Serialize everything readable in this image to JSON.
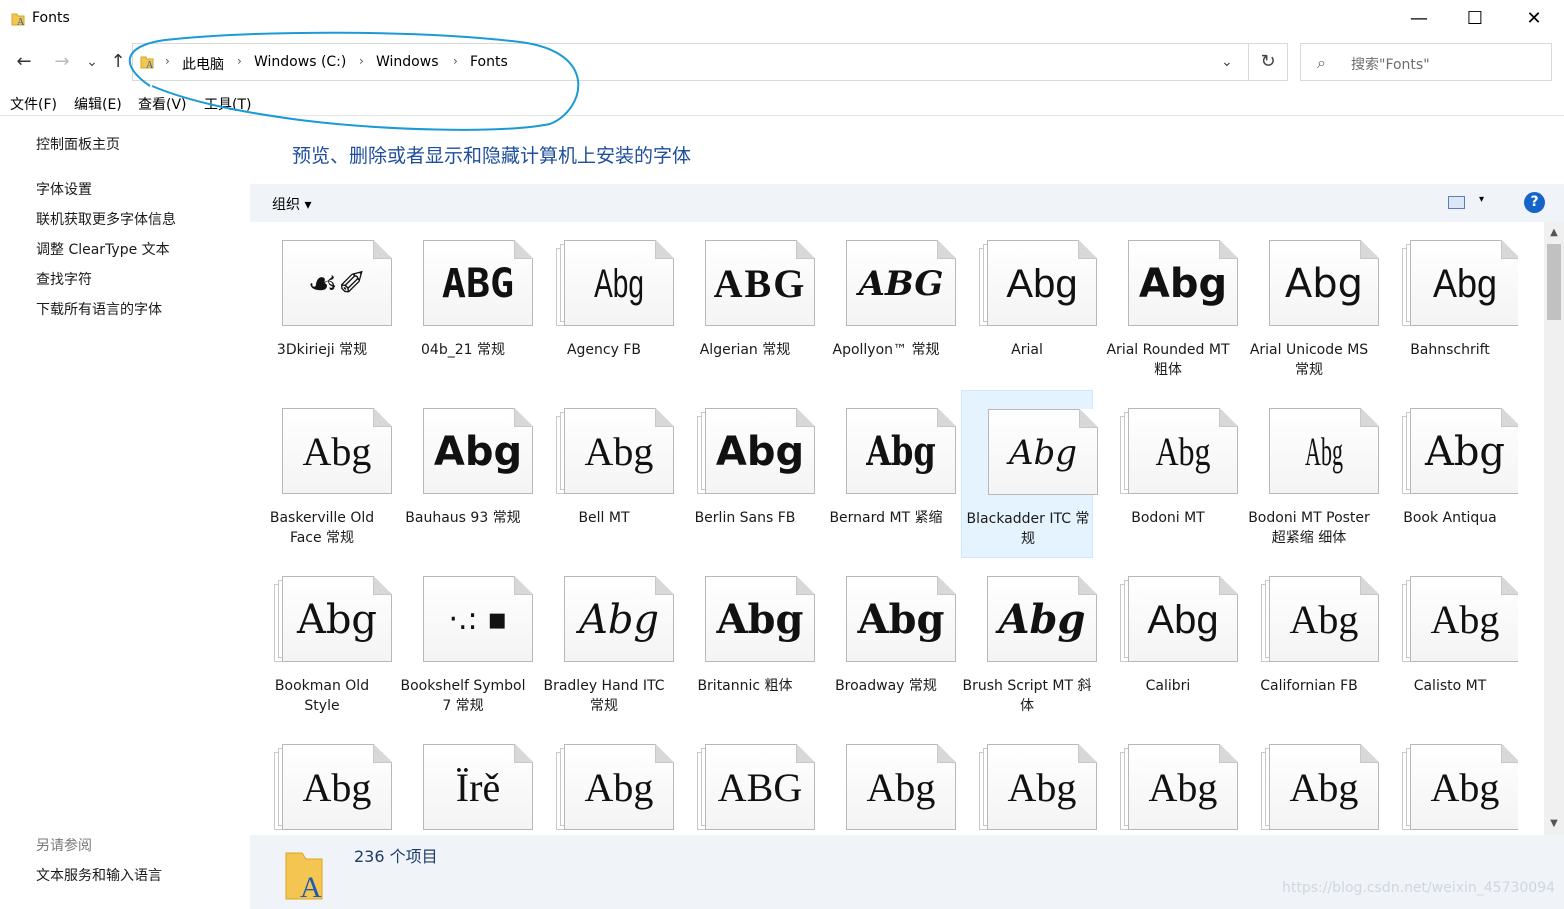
{
  "window": {
    "title": "Fonts",
    "minimize": "—",
    "maximize": "☐",
    "close": "✕"
  },
  "nav": {
    "back": "←",
    "forward": "→",
    "recent": "⌄",
    "up": "↑"
  },
  "address": {
    "segments": [
      "此电脑",
      "Windows (C:)",
      "Windows",
      "Fonts"
    ],
    "chevron": "›",
    "dropdown": "⌄",
    "refresh": "↻"
  },
  "search": {
    "icon": "⌕",
    "placeholder": "搜索\"Fonts\""
  },
  "menu": [
    "文件(F)",
    "编辑(E)",
    "查看(V)",
    "工具(T)"
  ],
  "sidebar": {
    "home": "控制面板主页",
    "links": [
      "字体设置",
      "联机获取更多字体信息",
      "调整 ClearType 文本",
      "查找字符",
      "下载所有语言的字体"
    ],
    "see_also_title": "另请参阅",
    "see_also": [
      "文本服务和输入语言"
    ]
  },
  "heading": "预览、删除或者显示和隐藏计算机上安装的字体",
  "toolbar": {
    "organize": "组织 ▾",
    "view_dropdown": "▾",
    "help": "?"
  },
  "fonts": [
    {
      "name": "3Dkirieji 常规",
      "sample": "☙✐",
      "stack": false
    },
    {
      "name": "04b_21 常规",
      "sample": "ABG",
      "stack": false
    },
    {
      "name": "Agency FB",
      "sample": "Abg",
      "stack": true
    },
    {
      "name": "Algerian 常规",
      "sample": "ABG",
      "stack": false
    },
    {
      "name": "Apollyon™ 常规",
      "sample": "ABG",
      "stack": false
    },
    {
      "name": "Arial",
      "sample": "Abg",
      "stack": true
    },
    {
      "name": "Arial Rounded MT 粗体",
      "sample": "Abg",
      "stack": false
    },
    {
      "name": "Arial Unicode MS 常规",
      "sample": "Abg",
      "stack": false
    },
    {
      "name": "Bahnschrift",
      "sample": "Abg",
      "stack": true
    },
    {
      "name": "Baskerville Old Face 常规",
      "sample": "Abg",
      "stack": false
    },
    {
      "name": "Bauhaus 93 常规",
      "sample": "Abg",
      "stack": false
    },
    {
      "name": "Bell MT",
      "sample": "Abg",
      "stack": true
    },
    {
      "name": "Berlin Sans FB",
      "sample": "Abg",
      "stack": true
    },
    {
      "name": "Bernard MT 紧缩",
      "sample": "Abg",
      "stack": false
    },
    {
      "name": "Blackadder ITC 常规",
      "sample": "Abg",
      "stack": false,
      "selected": true
    },
    {
      "name": "Bodoni MT",
      "sample": "Abg",
      "stack": true
    },
    {
      "name": "Bodoni MT Poster 超紧缩 细体",
      "sample": "Abg",
      "stack": false
    },
    {
      "name": "Book Antiqua",
      "sample": "Abg",
      "stack": true
    },
    {
      "name": "Bookman Old Style",
      "sample": "Abg",
      "stack": true
    },
    {
      "name": "Bookshelf Symbol 7 常规",
      "sample": "·.: ▪",
      "stack": false
    },
    {
      "name": "Bradley Hand ITC 常规",
      "sample": "Abg",
      "stack": false
    },
    {
      "name": "Britannic 粗体",
      "sample": "Abg",
      "stack": false
    },
    {
      "name": "Broadway 常规",
      "sample": "Abg",
      "stack": false
    },
    {
      "name": "Brush Script MT 斜体",
      "sample": "Abg",
      "stack": false
    },
    {
      "name": "Calibri",
      "sample": "Abg",
      "stack": true
    },
    {
      "name": "Californian FB",
      "sample": "Abg",
      "stack": true
    },
    {
      "name": "Calisto MT",
      "sample": "Abg",
      "stack": true
    },
    {
      "name": "",
      "sample": "Abg",
      "stack": true
    },
    {
      "name": "",
      "sample": "Ïrě",
      "stack": false
    },
    {
      "name": "",
      "sample": "Abg",
      "stack": true
    },
    {
      "name": "",
      "sample": "ABG",
      "stack": true
    },
    {
      "name": "",
      "sample": "Abg",
      "stack": false
    },
    {
      "name": "",
      "sample": "Abg",
      "stack": true
    },
    {
      "name": "",
      "sample": "Abg",
      "stack": true
    },
    {
      "name": "",
      "sample": "Abg",
      "stack": true
    },
    {
      "name": "",
      "sample": "Abg",
      "stack": true
    }
  ],
  "status": {
    "count": "236 个项目"
  },
  "watermark": "https://blog.csdn.net/weixin_45730094",
  "colors": {
    "accent": "#1e4e9c",
    "toolbar_bg": "#f0f4f9",
    "annotation": "#1b9ad6",
    "selected_bg": "#e5f3ff"
  },
  "icons": {
    "folder": "font-folder-icon"
  }
}
